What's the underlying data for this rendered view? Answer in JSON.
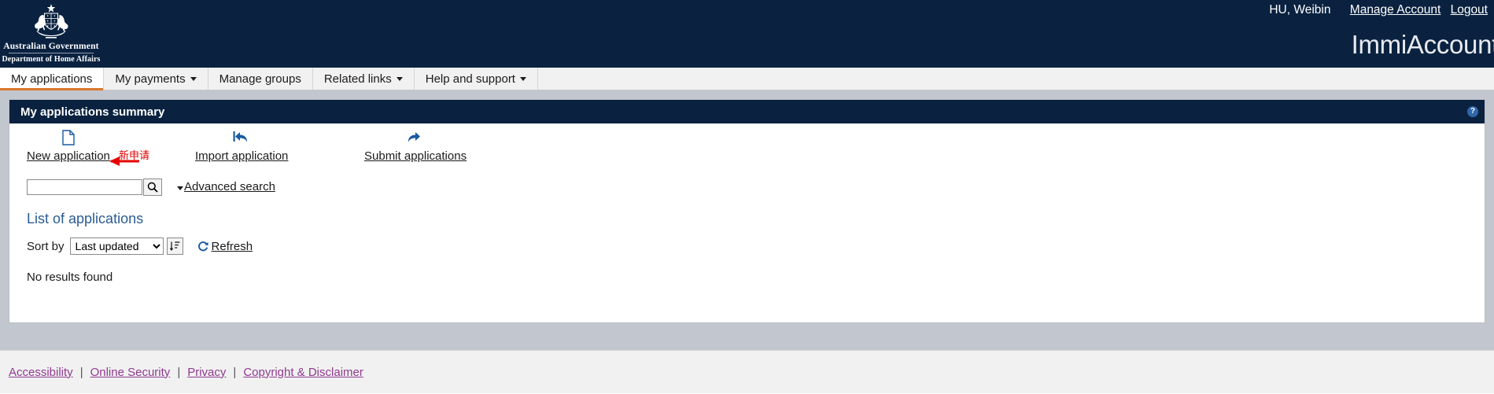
{
  "header": {
    "crest_icon": "australian-coat-of-arms",
    "gov_line1": "Australian Government",
    "gov_line2": "Department of Home Affairs",
    "user_name": "HU, Weibin",
    "manage_account_label": "Manage Account",
    "logout_label": "Logout",
    "wordmark": "ImmiAccount",
    "bg_color": "#0a2240"
  },
  "nav": {
    "tabs": [
      {
        "label": "My applications",
        "has_caret": false,
        "active": true
      },
      {
        "label": "My payments",
        "has_caret": true,
        "active": false
      },
      {
        "label": "Manage groups",
        "has_caret": false,
        "active": false
      },
      {
        "label": "Related links",
        "has_caret": true,
        "active": false
      },
      {
        "label": "Help and support",
        "has_caret": true,
        "active": false
      }
    ],
    "active_indicator_color": "#d9772b"
  },
  "panel": {
    "title": "My applications summary",
    "help_icon": "question-mark-icon",
    "help_label": "?",
    "actions": [
      {
        "label": "New application",
        "icon": "new-document-icon"
      },
      {
        "label": "Import application",
        "icon": "import-arrow-icon"
      },
      {
        "label": "Submit applications",
        "icon": "submit-arrow-icon"
      }
    ],
    "annotation": {
      "icon": "red-arrow-icon",
      "text": "新申请",
      "color": "#e60000"
    },
    "search": {
      "value": "",
      "placeholder": "",
      "button_icon": "search-icon",
      "advanced_label": "Advanced search",
      "advanced_caret_icon": "chevron-down-icon"
    },
    "list_heading": "List of applications",
    "sort": {
      "label": "Sort by",
      "selected": "Last updated",
      "options": [
        "Last updated"
      ],
      "direction_icon": "sort-descending-icon",
      "refresh_icon": "refresh-icon",
      "refresh_label": "Refresh"
    },
    "empty_message": "No results found"
  },
  "footer": {
    "links": [
      "Accessibility",
      "Online Security",
      "Privacy",
      "Copyright & Disclaimer"
    ],
    "separator": "|",
    "link_color": "#8f3a8f"
  }
}
